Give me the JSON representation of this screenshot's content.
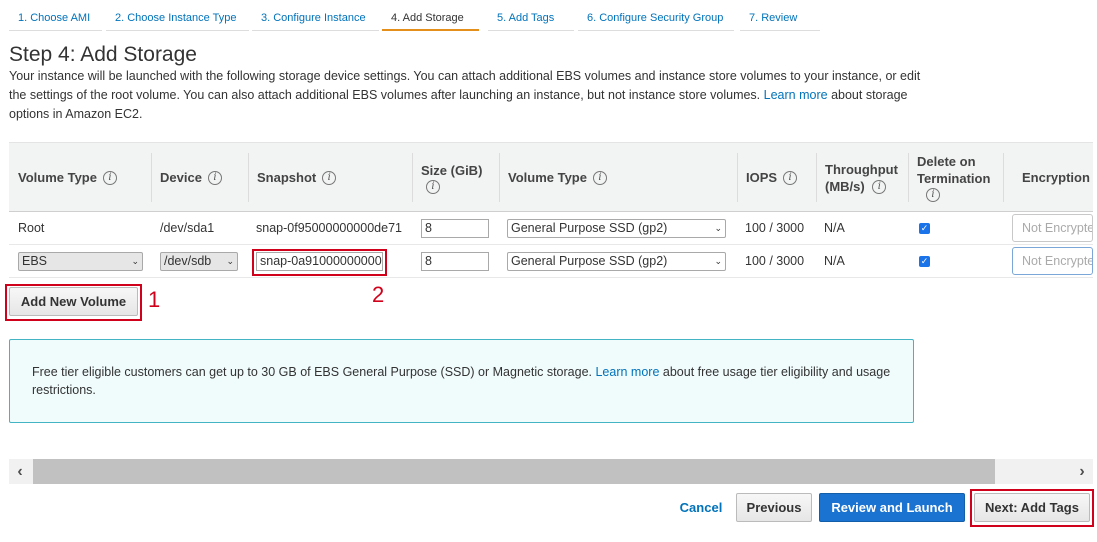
{
  "tabs": [
    {
      "label": "1. Choose AMI",
      "active": false
    },
    {
      "label": "2. Choose Instance Type",
      "active": false
    },
    {
      "label": "3. Configure Instance",
      "active": false
    },
    {
      "label": "4. Add Storage",
      "active": true
    },
    {
      "label": "5. Add Tags",
      "active": false
    },
    {
      "label": "6. Configure Security Group",
      "active": false
    },
    {
      "label": "7. Review",
      "active": false
    }
  ],
  "page": {
    "title": "Step 4: Add Storage",
    "intro_text": "Your instance will be launched with the following storage device settings. You can attach additional EBS volumes and instance store volumes to your instance, or edit the settings of the root volume. You can also attach additional EBS volumes after launching an instance, but not instance store volumes.",
    "intro_link": "Learn more",
    "intro_tail": "about storage options in Amazon EC2."
  },
  "table": {
    "headers": {
      "volume_type": "Volume Type",
      "device": "Device",
      "snapshot": "Snapshot",
      "size": "Size (GiB)",
      "ebs_volume_type": "Volume Type",
      "iops": "IOPS",
      "throughput": "Throughput (MB/s)",
      "delete_on_termination": "Delete on Termination",
      "encryption": "Encryption"
    },
    "info_icon": "i",
    "rows": [
      {
        "volume_type": "Root",
        "device": "/dev/sda1",
        "snapshot": "snap-0f95000000000de71",
        "size": "8",
        "ebs_volume_type": "General Purpose SSD (gp2)",
        "iops": "100 / 3000",
        "throughput": "N/A",
        "delete_on_termination": true,
        "encryption_placeholder": "Not Encrypted"
      },
      {
        "volume_type": "EBS",
        "device": "/dev/sdb",
        "snapshot": "snap-0a91000000000",
        "size": "8",
        "ebs_volume_type": "General Purpose SSD (gp2)",
        "iops": "100 / 3000",
        "throughput": "N/A",
        "delete_on_termination": true,
        "encryption_placeholder": "Not Encrypted"
      }
    ]
  },
  "add_volume_button": "Add New Volume",
  "annotations": {
    "marker_1": "1",
    "marker_2": "2",
    "color": "#d0021b"
  },
  "free_tier": {
    "text": "Free tier eligible customers can get up to 30 GB of EBS General Purpose (SSD) or Magnetic storage.",
    "link": "Learn more",
    "tail": "about free usage tier eligibility and usage restrictions."
  },
  "footer": {
    "cancel": "Cancel",
    "previous": "Previous",
    "review_launch": "Review and Launch",
    "next": "Next: Add Tags"
  },
  "scrollbar": {
    "left_arrow": "‹",
    "right_arrow": "›"
  },
  "colors": {
    "link": "#0073bb",
    "primary": "#1a73d1",
    "active_tab_underline": "#e48f1c",
    "annotation": "#d0021b",
    "info_border": "#43b4c3"
  }
}
